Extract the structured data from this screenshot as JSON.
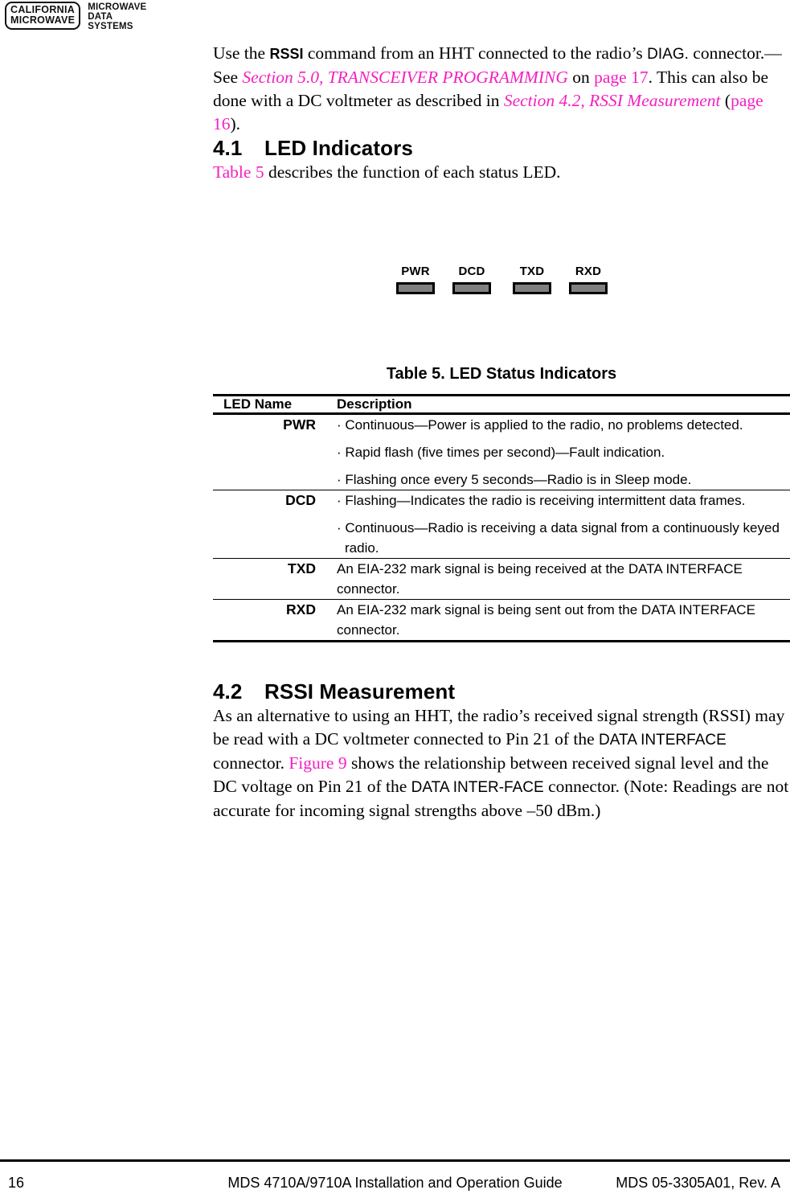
{
  "logo": {
    "badge_line1": "CALIFORNIA",
    "badge_line2": "MICROWAVE",
    "word_line1": "MICROWAVE",
    "word_line2": "DATA",
    "word_line3": "SYSTEMS"
  },
  "link_color": "#f41fc0",
  "led_color": "#808080",
  "intro": {
    "t1": "Use the ",
    "rssi": "RSSI",
    "t2": " command from an HHT connected to the radio’s ",
    "diag": "DIAG.",
    "t3": " connector.—See ",
    "link_section5": "Section 5.0, TRANSCEIVER PROGRAMMING",
    "t4": " on ",
    "link_page17": "page 17",
    "t5": ". This can also be done with a DC voltmeter as described in ",
    "link_section42": "Section 4.2, RSSI Measurement",
    "t6": " (",
    "link_page16": "page 16",
    "t7": ")."
  },
  "section41": {
    "number": "4.1",
    "title": "LED Indicators",
    "para_link": "Table 5",
    "para_rest": " describes the function of each status LED."
  },
  "led_figure": {
    "leds": [
      {
        "label": "PWR"
      },
      {
        "label": "DCD"
      },
      {
        "label": "TXD"
      },
      {
        "label": "RXD"
      }
    ]
  },
  "table5": {
    "caption": "Table 5. LED Status Indicators",
    "headers": {
      "name": "LED Name",
      "description": "Description"
    },
    "rows": [
      {
        "name": "PWR",
        "lines": [
          "· Continuous—Power is applied to the radio, no problems detected.",
          "· Rapid flash (five times per second)—Fault indication.",
          "· Flashing once every 5 seconds—Radio is in Sleep mode."
        ]
      },
      {
        "name": "DCD",
        "lines": [
          "· Flashing—Indicates the radio is receiving intermittent data frames.",
          "· Continuous—Radio is receiving a data signal from a continuously keyed radio."
        ]
      },
      {
        "name": "TXD",
        "lines": [
          "An EIA-232 mark signal is being received at the DATA INTERFACE connector."
        ]
      },
      {
        "name": "RXD",
        "lines": [
          "An EIA-232 mark signal is being sent out from the DATA INTERFACE connector."
        ]
      }
    ]
  },
  "section42": {
    "number": "4.2",
    "title": "RSSI Measurement",
    "p1": "As an alternative to using an HHT, the radio’s received signal strength (RSSI) may be read with a DC voltmeter connected to Pin 21 of the ",
    "data_interface_1": "DATA INTERFACE",
    "p2": " connector. ",
    "link_figure9": "Figure 9",
    "p3": " shows the relationship between received signal level and the DC voltage on Pin 21 of the ",
    "data_interface_2": "DATA INTER-FACE",
    "p4": " connector. (Note: Readings are not accurate for incoming signal strengths above –50 dBm.)"
  },
  "footer": {
    "page_number": "16",
    "guide_title": "MDS 4710A/9710A Installation and Operation Guide",
    "doc_number": "MDS 05-3305A01, Rev. A"
  }
}
